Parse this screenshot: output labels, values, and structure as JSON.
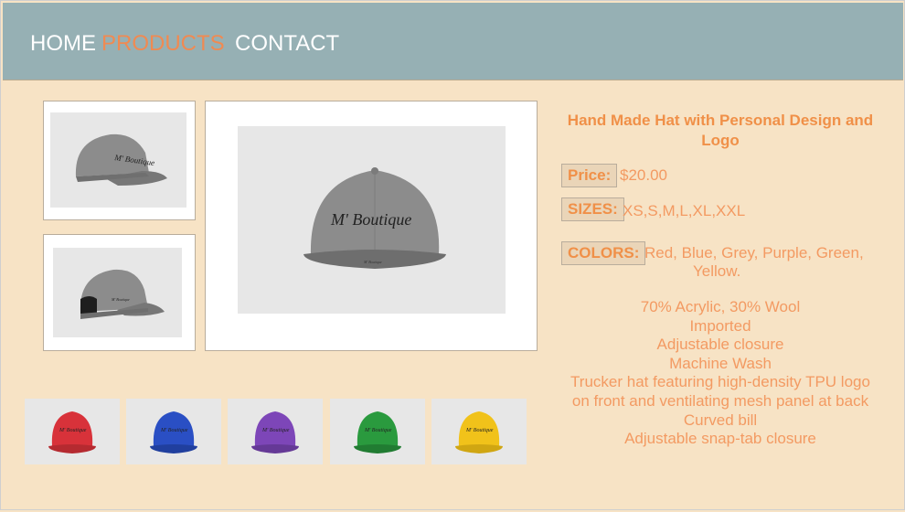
{
  "nav": {
    "home": "HOME",
    "products": "PRODUCTS",
    "contact": "CONTACT"
  },
  "product": {
    "title": "Hand Made Hat with Personal Design and Logo",
    "brand_text": "M' Boutique",
    "price_label": "Price:",
    "price_value": "$20.00",
    "sizes_label": "SIZES:",
    "sizes_value": "XS,S,M,L,XL,XXL",
    "colors_label": "COLORS:",
    "colors_value_line1": "Red, Blue, Grey, Purple, Green,",
    "colors_value_line2": "Yellow.",
    "description": [
      "70% Acrylic, 30% Wool",
      "Imported",
      "Adjustable closure",
      "Machine Wash",
      "Trucker hat featuring high-density TPU logo",
      "on front and ventilating mesh panel at back",
      "Curved bill",
      "Adjustable snap-tab closure"
    ]
  },
  "swatches": [
    {
      "color": "#d8323a"
    },
    {
      "color": "#2a4fc4"
    },
    {
      "color": "#7d46b8"
    },
    {
      "color": "#2a9a3e"
    },
    {
      "color": "#f1c21a"
    }
  ],
  "colors": {
    "nav_bg": "#96b0b4",
    "page_bg": "#f7e3c5",
    "accent": "#f08a52",
    "hat_grey": "#8e8e8e"
  }
}
